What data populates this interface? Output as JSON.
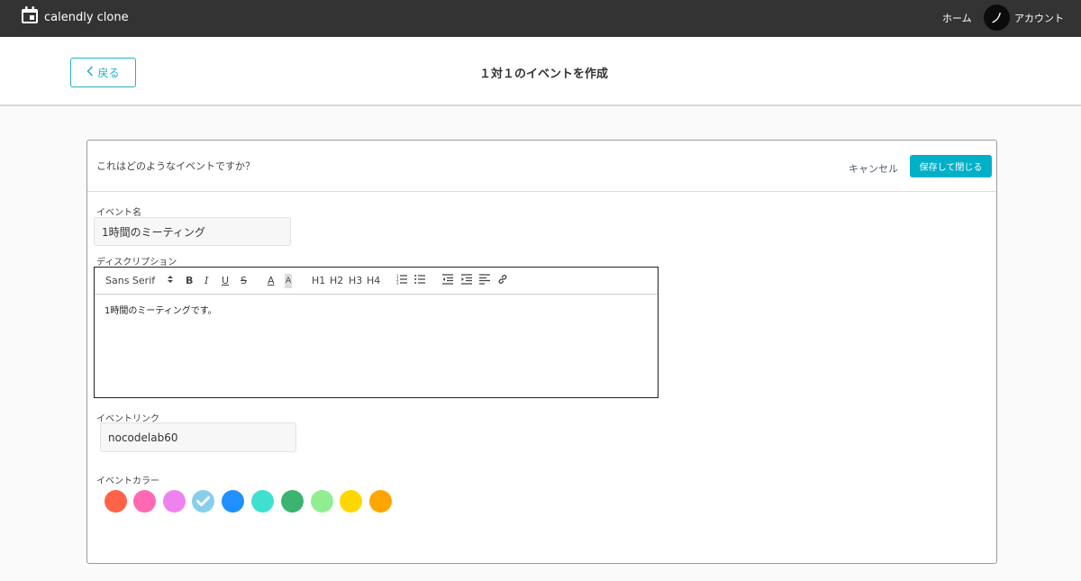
{
  "appbar": {
    "brand": "calendly clone",
    "icon": "calendar-icon",
    "home": "ホーム",
    "avatar_initial": "ノ",
    "account": "アカウント"
  },
  "subheader": {
    "back_label": "戻る",
    "title": "１対１のイベントを作成"
  },
  "card": {
    "question": "これはどのようなイベントですか？",
    "cancel": "キャンセル",
    "save": "保存して閉じる"
  },
  "form": {
    "event_name_label": "イベント名",
    "event_name_value": "1時間のミーティング",
    "description_label": "ディスクリプション",
    "description_value": "1時間のミーティングです。",
    "link_label": "イベントリンク",
    "link_value": "nocodelab60",
    "color_label": "イベントカラー"
  },
  "toolbar": {
    "font": "Sans Serif",
    "bold": "B",
    "italic": "I",
    "underline": "U",
    "strike": "S",
    "font_color": "A",
    "background": "A",
    "h1": "H1",
    "h2": "H2",
    "h3": "H3",
    "h4": "H4"
  },
  "colors": [
    {
      "name": "tomato",
      "hex": "#ff6347",
      "selected": false
    },
    {
      "name": "hotpink",
      "hex": "#ff69b4",
      "selected": false
    },
    {
      "name": "violet",
      "hex": "#ee82ee",
      "selected": false
    },
    {
      "name": "lightskyblue",
      "hex": "#87ceeb",
      "selected": true
    },
    {
      "name": "dodgerblue",
      "hex": "#1e90ff",
      "selected": false
    },
    {
      "name": "turquoise",
      "hex": "#40e0d0",
      "selected": false
    },
    {
      "name": "mediumseagreen",
      "hex": "#3cb371",
      "selected": false
    },
    {
      "name": "lightgreen",
      "hex": "#90ee90",
      "selected": false
    },
    {
      "name": "gold",
      "hex": "#ffd700",
      "selected": false
    },
    {
      "name": "orange",
      "hex": "#ffa500",
      "selected": false
    }
  ],
  "theme": {
    "accent": "#00b0c7",
    "appbar_bg": "#333333"
  }
}
